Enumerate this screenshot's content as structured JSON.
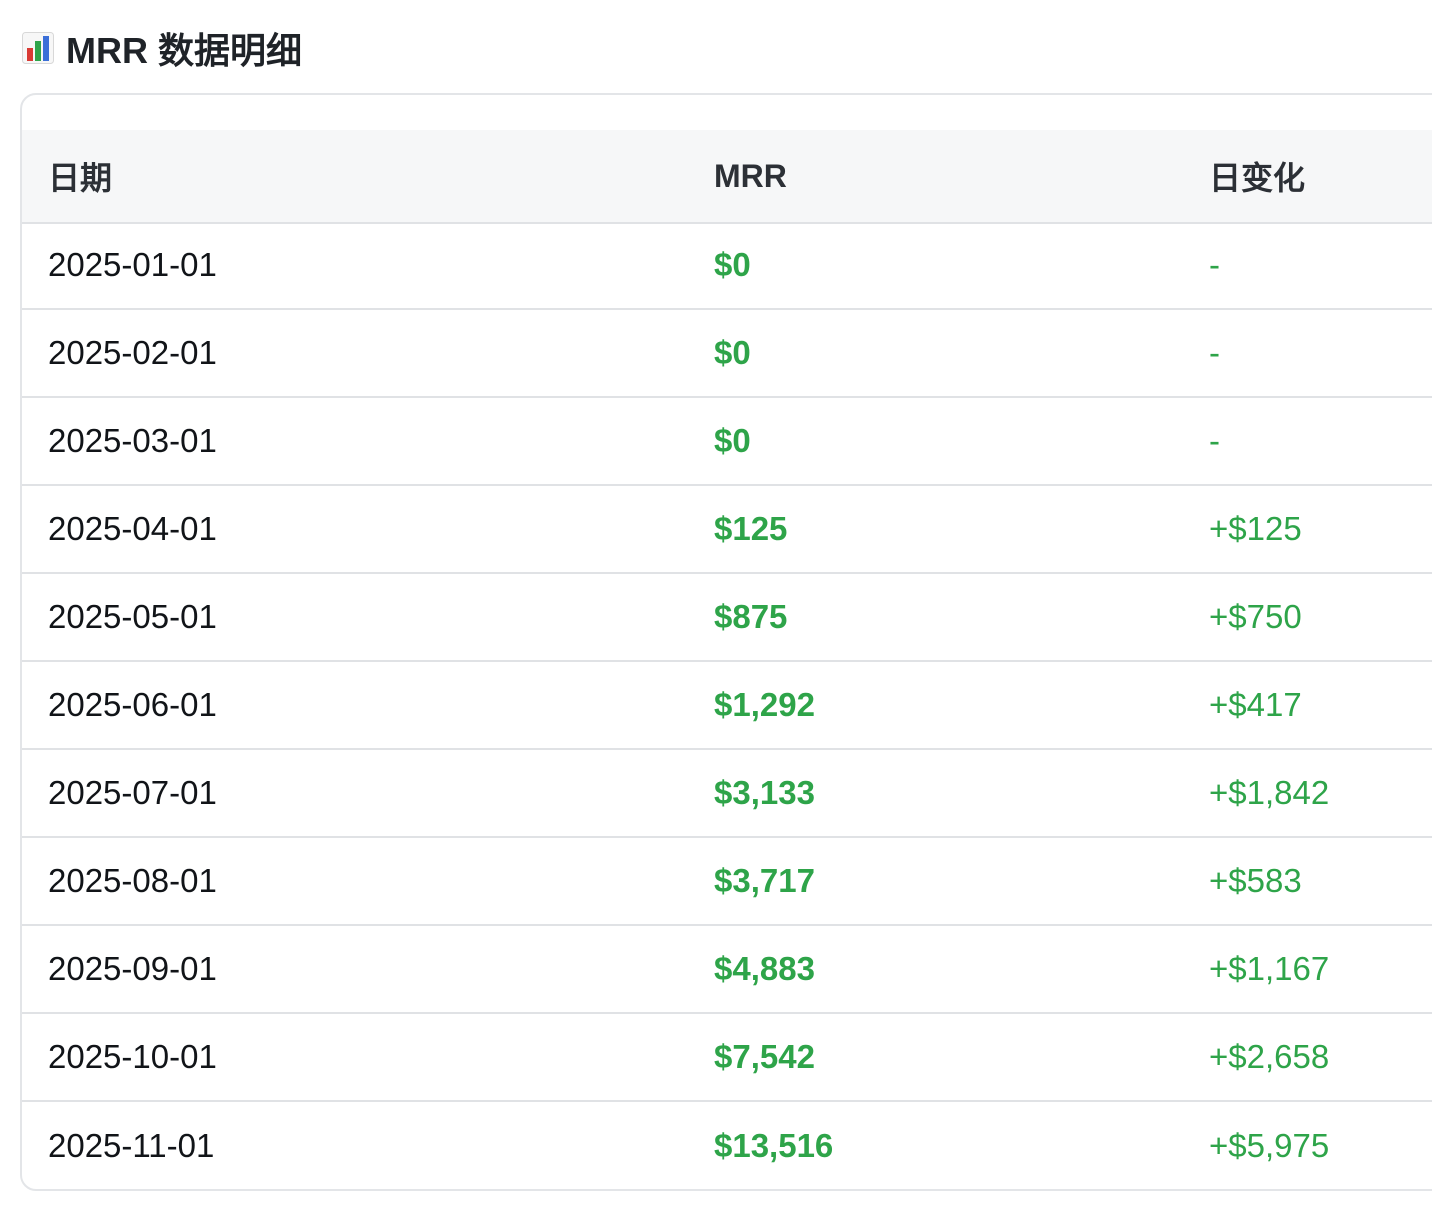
{
  "title": {
    "icon": "bar-chart-icon",
    "text": "MRR 数据明细"
  },
  "colors": {
    "positive": "#2ea449",
    "border": "#e0e2e5",
    "header_bg": "#f6f7f8",
    "icon_red": "#d93a34",
    "icon_green": "#2ea449",
    "icon_blue": "#3b6fd8"
  },
  "table": {
    "columns": [
      "日期",
      "MRR",
      "日变化"
    ],
    "rows": [
      {
        "date": "2025-01-01",
        "mrr": "$0",
        "change": "-"
      },
      {
        "date": "2025-02-01",
        "mrr": "$0",
        "change": "-"
      },
      {
        "date": "2025-03-01",
        "mrr": "$0",
        "change": "-"
      },
      {
        "date": "2025-04-01",
        "mrr": "$125",
        "change": "+$125"
      },
      {
        "date": "2025-05-01",
        "mrr": "$875",
        "change": "+$750"
      },
      {
        "date": "2025-06-01",
        "mrr": "$1,292",
        "change": "+$417"
      },
      {
        "date": "2025-07-01",
        "mrr": "$3,133",
        "change": "+$1,842"
      },
      {
        "date": "2025-08-01",
        "mrr": "$3,717",
        "change": "+$583"
      },
      {
        "date": "2025-09-01",
        "mrr": "$4,883",
        "change": "+$1,167"
      },
      {
        "date": "2025-10-01",
        "mrr": "$7,542",
        "change": "+$2,658"
      },
      {
        "date": "2025-11-01",
        "mrr": "$13,516",
        "change": "+$5,975"
      }
    ]
  }
}
